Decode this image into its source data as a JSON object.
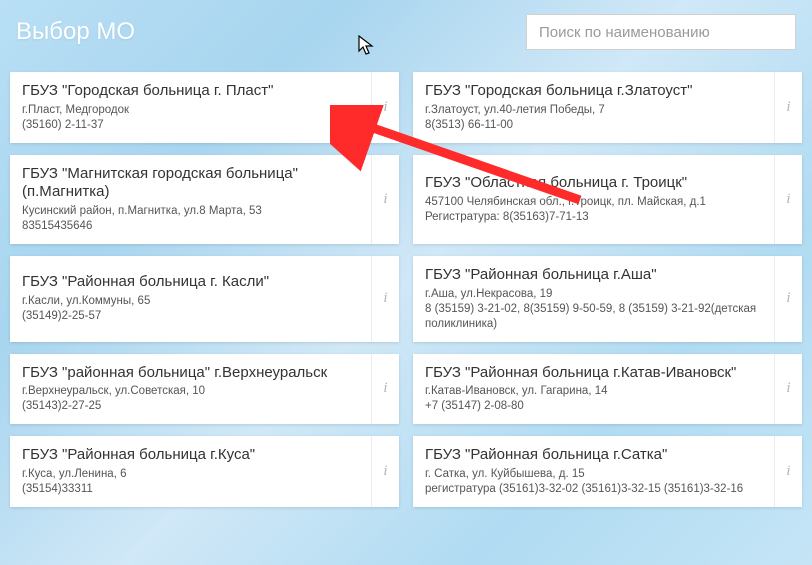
{
  "header": {
    "title": "Выбор МО"
  },
  "search": {
    "placeholder": "Поиск по наименованию"
  },
  "info_glyph": "i",
  "cards": [
    {
      "title": "ГБУЗ \"Городская больница г. Пласт\"",
      "line1": "г.Пласт, Медгородок",
      "line2": "(35160) 2-11-37"
    },
    {
      "title": "ГБУЗ \"Городская больница г.Златоуст\"",
      "line1": "г.Златоуст, ул.40-летия Победы, 7",
      "line2": "8(3513) 66-11-00"
    },
    {
      "title": "ГБУЗ \"Магнитская городская больница\" (п.Магнитка)",
      "line1": "Кусинский район, п.Магнитка, ул.8 Марта, 53",
      "line2": "83515435646"
    },
    {
      "title": "ГБУЗ \"Областная больница г. Троицк\"",
      "line1": "457100 Челябинская обл., г.Троицк, пл. Майская, д.1",
      "line2": "Регистратура: 8(35163)7-71-13"
    },
    {
      "title": "ГБУЗ \"Районная больница г. Касли\"",
      "line1": "г.Касли, ул.Коммуны, 65",
      "line2": "(35149)2-25-57"
    },
    {
      "title": "ГБУЗ \"Районная больница г.Аша\"",
      "line1": "г.Аша, ул.Некрасова, 19",
      "line2": "8 (35159) 3-21-02, 8(35159) 9-50-59, 8 (35159) 3-21-92(детская поликлиника)"
    },
    {
      "title": "ГБУЗ \"районная больница\" г.Верхнеуральск",
      "line1": "г.Верхнеуральск, ул.Советская, 10",
      "line2": "(35143)2-27-25"
    },
    {
      "title": "ГБУЗ \"Районная больница г.Катав-Ивановск\"",
      "line1": "г.Катав-Ивановск, ул. Гагарина, 14",
      "line2": "+7 (35147) 2-08-80"
    },
    {
      "title": "ГБУЗ \"Районная больница г.Куса\"",
      "line1": "г.Куса, ул.Ленина, 6",
      "line2": "(35154)33311"
    },
    {
      "title": "ГБУЗ \"Районная больница г.Сатка\"",
      "line1": "г. Сатка, ул. Куйбышева, д. 15",
      "line2": "регистратура (35161)3-32-02 (35161)3-32-15 (35161)3-32-16"
    }
  ]
}
